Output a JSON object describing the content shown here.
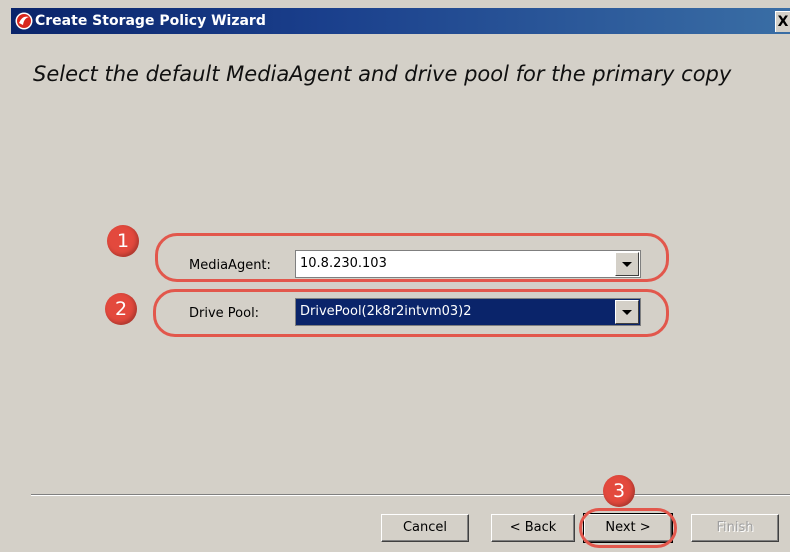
{
  "window": {
    "title": "Create Storage Policy Wizard",
    "close_glyph": "X"
  },
  "heading": "Select the default MediaAgent and drive pool for the primary copy",
  "fields": {
    "media_agent": {
      "label": "MediaAgent:",
      "value": "10.8.230.103"
    },
    "drive_pool": {
      "label": "Drive Pool:",
      "value": "DrivePool(2k8r2intvm03)2"
    }
  },
  "annotations": {
    "badge1": "1",
    "badge2": "2",
    "badge3": "3",
    "color": "#e3493d"
  },
  "buttons": {
    "cancel": "Cancel",
    "back": "< Back",
    "next": "Next >",
    "finish": "Finish"
  },
  "colors": {
    "titlebar": "#0a246a",
    "dialog_bg": "#d4d0c8",
    "selection": "#0a246a"
  },
  "icons": {
    "app_logo": "commvault-logo-icon",
    "dropdown": "chevron-down-icon"
  }
}
